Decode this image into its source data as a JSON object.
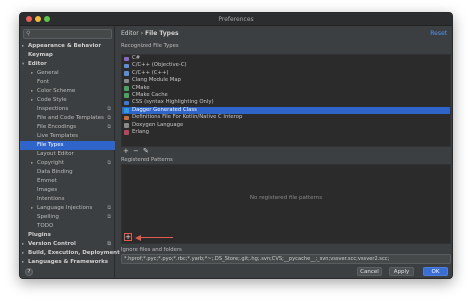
{
  "window": {
    "title": "Preferences"
  },
  "search": {
    "placeholder": ""
  },
  "sidebar": {
    "items": [
      {
        "label": "Appearance & Behavior",
        "bold": true,
        "indent": 0,
        "arrow": "▸"
      },
      {
        "label": "Keymap",
        "bold": true,
        "indent": 0,
        "arrow": ""
      },
      {
        "label": "Editor",
        "bold": true,
        "indent": 0,
        "arrow": "▾"
      },
      {
        "label": "General",
        "indent": 1,
        "arrow": "▸"
      },
      {
        "label": "Font",
        "indent": 1,
        "arrow": ""
      },
      {
        "label": "Color Scheme",
        "indent": 1,
        "arrow": "▸"
      },
      {
        "label": "Code Style",
        "indent": 1,
        "arrow": "▸"
      },
      {
        "label": "Inspections",
        "indent": 1,
        "arrow": "",
        "copy": true
      },
      {
        "label": "File and Code Templates",
        "indent": 1,
        "arrow": "",
        "copy": true
      },
      {
        "label": "File Encodings",
        "indent": 1,
        "arrow": "",
        "copy": true
      },
      {
        "label": "Live Templates",
        "indent": 1,
        "arrow": ""
      },
      {
        "label": "File Types",
        "indent": 1,
        "arrow": "",
        "selected": true
      },
      {
        "label": "Layout Editor",
        "indent": 1,
        "arrow": ""
      },
      {
        "label": "Copyright",
        "indent": 1,
        "arrow": "▸",
        "copy": true
      },
      {
        "label": "Data Binding",
        "indent": 1,
        "arrow": ""
      },
      {
        "label": "Emmet",
        "indent": 1,
        "arrow": ""
      },
      {
        "label": "Images",
        "indent": 1,
        "arrow": ""
      },
      {
        "label": "Intentions",
        "indent": 1,
        "arrow": ""
      },
      {
        "label": "Language Injections",
        "indent": 1,
        "arrow": "▸",
        "copy": true
      },
      {
        "label": "Spelling",
        "indent": 1,
        "arrow": "",
        "copy": true
      },
      {
        "label": "TODO",
        "indent": 1,
        "arrow": ""
      },
      {
        "label": "Plugins",
        "bold": true,
        "indent": 0,
        "arrow": ""
      },
      {
        "label": "Version Control",
        "bold": true,
        "indent": 0,
        "arrow": "▸",
        "copy": true
      },
      {
        "label": "Build, Execution, Deployment",
        "bold": true,
        "indent": 0,
        "arrow": "▸"
      },
      {
        "label": "Languages & Frameworks",
        "bold": true,
        "indent": 0,
        "arrow": "▸"
      }
    ]
  },
  "header": {
    "crumb_root": "Editor",
    "crumb_sep": "›",
    "crumb_leaf": "File Types",
    "reset_label": "Reset"
  },
  "recognized": {
    "label": "Recognized File Types",
    "items": [
      {
        "label": "C#",
        "color": "#8a66c9"
      },
      {
        "label": "C/C++ (Objective-C)",
        "color": "#5d8fd6"
      },
      {
        "label": "C/C++ (C++)",
        "color": "#5d8fd6"
      },
      {
        "label": "Clang Module Map",
        "color": "#8a8a8a"
      },
      {
        "label": "CMake",
        "color": "#4aa363"
      },
      {
        "label": "CMake Cache",
        "color": "#4aa363"
      },
      {
        "label": "CSS (syntax Highlighting Only)",
        "color": "#3a7bd5"
      },
      {
        "label": "Dagger Generated Class",
        "color": "#2f9ed8",
        "selected": true
      },
      {
        "label": "Definitions File For Kotlin/Native C Interop",
        "color": "#c96b3a"
      },
      {
        "label": "Doxygen Language",
        "color": "#8a8a8a"
      },
      {
        "label": "Erlang",
        "color": "#b5465c"
      }
    ],
    "tools": {
      "add": "+",
      "remove": "−",
      "edit": "✎"
    }
  },
  "patterns": {
    "label": "Registered Patterns",
    "empty_text": "No registered file patterns",
    "add": "+"
  },
  "ignore": {
    "label": "Ignore files and folders",
    "value": "*.hprof;*.pyc;*.pyo;*.rbc;*.yarb;*~;.DS_Store;.git;.hg;.svn;CVS;__pycache__;_svn;vssver.scc;vssver2.scc;"
  },
  "footer": {
    "help": "?",
    "cancel": "Cancel",
    "apply": "Apply",
    "ok": "OK"
  },
  "colors": {
    "accent": "#2f65ca",
    "link": "#5394ec",
    "annotation": "#e05a4f"
  }
}
